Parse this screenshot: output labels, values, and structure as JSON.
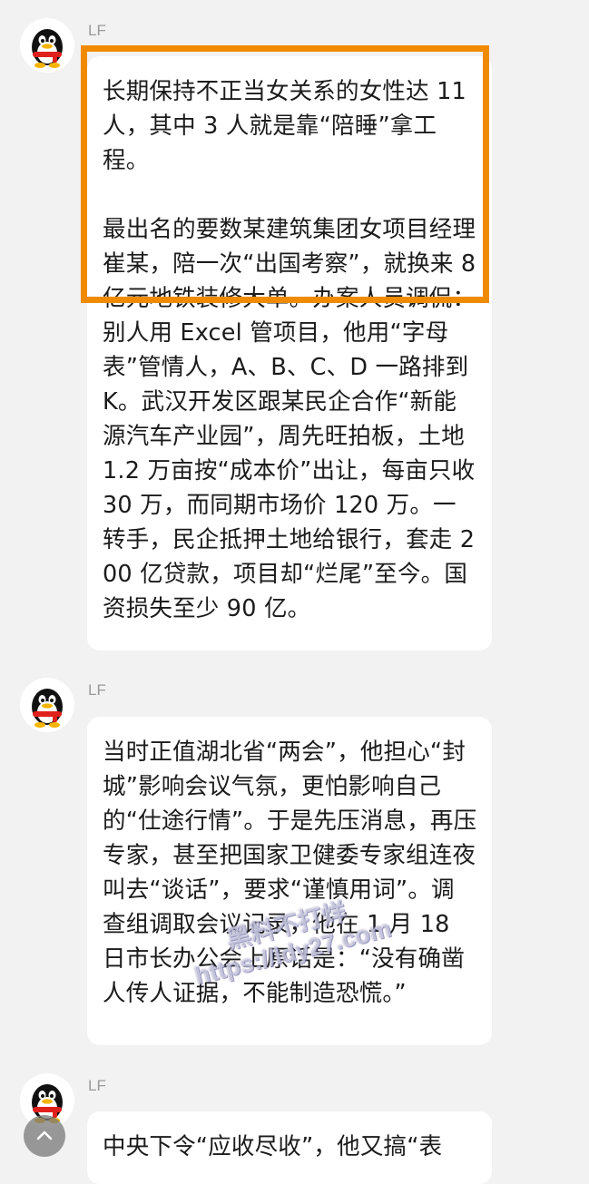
{
  "messages": [
    {
      "sender": "LF",
      "paragraphs": [
        "长期保持不正当女关系的女性达 11 人，其中 3 人就是靠“陪睡”拿工程。",
        "最出名的要数某建筑集团女项目经理崔某，陪一次“出国考察”，就换来 8 亿元地铁装修大单。办案人员调侃：别人用 Excel 管项目，他用“字母表”管情人，A、B、C、D 一路排到 K。武汉开发区跟某民企合作“新能源汽车产业园”，周先旺拍板，土地 1.2 万亩按“成本价”出让，每亩只收 30 万，而同期市场价 120 万。一转手，民企抵押土地给银行，套走 200 亿贷款，项目却“烂尾”至今。国资损失至少 90 亿。"
      ]
    },
    {
      "sender": "LF",
      "paragraphs": [
        "当时正值湖北省“两会”，他担心“封城”影响会议气氛，更怕影响自己的“仕途行情”。于是先压消息，再压专家，甚至把国家卫健委专家组连夜叫去“谈话”，要求“谨慎用词”。调查组调取会议记录，他在 1 月 18 日市长办公会上原话是：“没有确凿人传人证据，不能制造恐慌。”"
      ]
    },
    {
      "sender": "LF",
      "paragraphs": [
        "中央下令“应收尽收”，他又搞“表"
      ]
    }
  ],
  "watermark": {
    "line1": "黑料不打烊",
    "line2": "https://ldy27.com"
  },
  "colors": {
    "highlight_border": "#f08a00",
    "background": "#f2f2f2",
    "bubble": "#ffffff"
  },
  "icons": {
    "avatar": "qq-penguin-icon",
    "scroll_top": "chevron-up-icon"
  }
}
